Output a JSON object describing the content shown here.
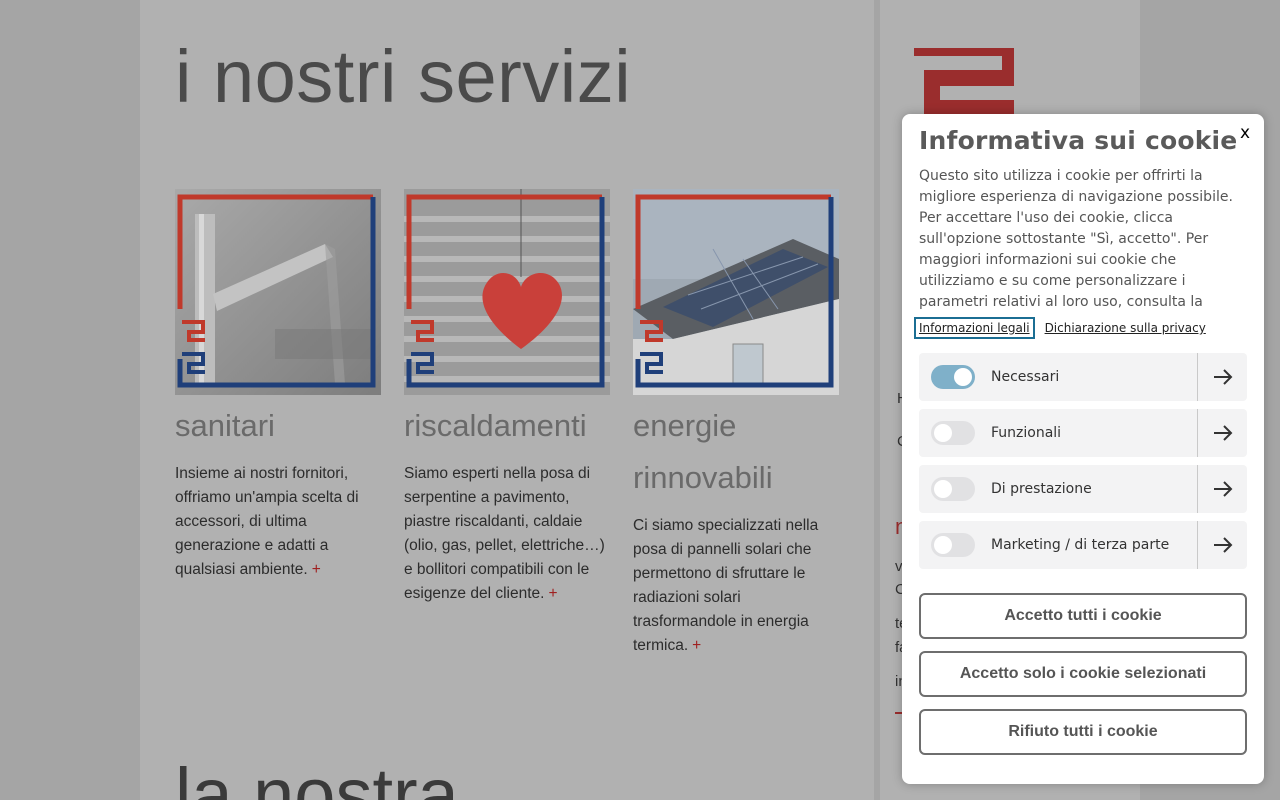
{
  "page": {
    "title": "i nostri servizi",
    "section2_title": "la nostra",
    "cards": [
      {
        "title": "sanitari",
        "text": "Insieme ai nostri fornitori, offriamo un'ampia scelta di accessori, di ultima generazione e adatti a qualsiasi ambiente.",
        "plus": "+"
      },
      {
        "title": "riscaldamenti",
        "text": "Siamo esperti nella posa di serpentine a pavimento, piastre riscaldanti, caldaie (olio, gas, pellet, elettriche…) e bollitori compatibili con le esigenze del cliente.",
        "plus": "+"
      },
      {
        "title": "energie rinnovabili",
        "text": "Ci siamo specializzati nella posa di pannelli solari che permettono di sfruttare le radiazioni solari trasformandole in energia termica.",
        "plus": "+"
      }
    ],
    "side_fragments": [
      "H",
      "C",
      "n",
      "v",
      "C",
      "te",
      "fa",
      "in"
    ]
  },
  "cookie": {
    "close_label": "x",
    "title": "Informativa sui cookie",
    "body": "Questo sito utilizza i cookie per offrirti la migliore esperienza di navigazione possibile. Per accettare l'uso dei cookie, clicca sull'opzione sottostante \"Sì, accetto\". Per maggiori informazioni sui cookie che utilizziamo e su come personalizzare i parametri relativi al loro uso, consulta la",
    "link_legal": "Informazioni legali",
    "link_privacy": "Dichiarazione sulla privacy",
    "categories": [
      {
        "label": "Necessari",
        "enabled": true
      },
      {
        "label": "Funzionali",
        "enabled": false
      },
      {
        "label": "Di prestazione",
        "enabled": false
      },
      {
        "label": "Marketing / di terza parte",
        "enabled": false
      }
    ],
    "buttons": {
      "accept_all": "Accetto tutti i cookie",
      "accept_selected": "Accetto solo i cookie selezionati",
      "reject_all": "Rifiuto tutti i cookie"
    },
    "colors": {
      "toggle_on": "#7fb0c9",
      "focus_border": "#1b6e93",
      "brand_red": "#c0392b",
      "brand_blue": "#1f3f7a"
    }
  }
}
